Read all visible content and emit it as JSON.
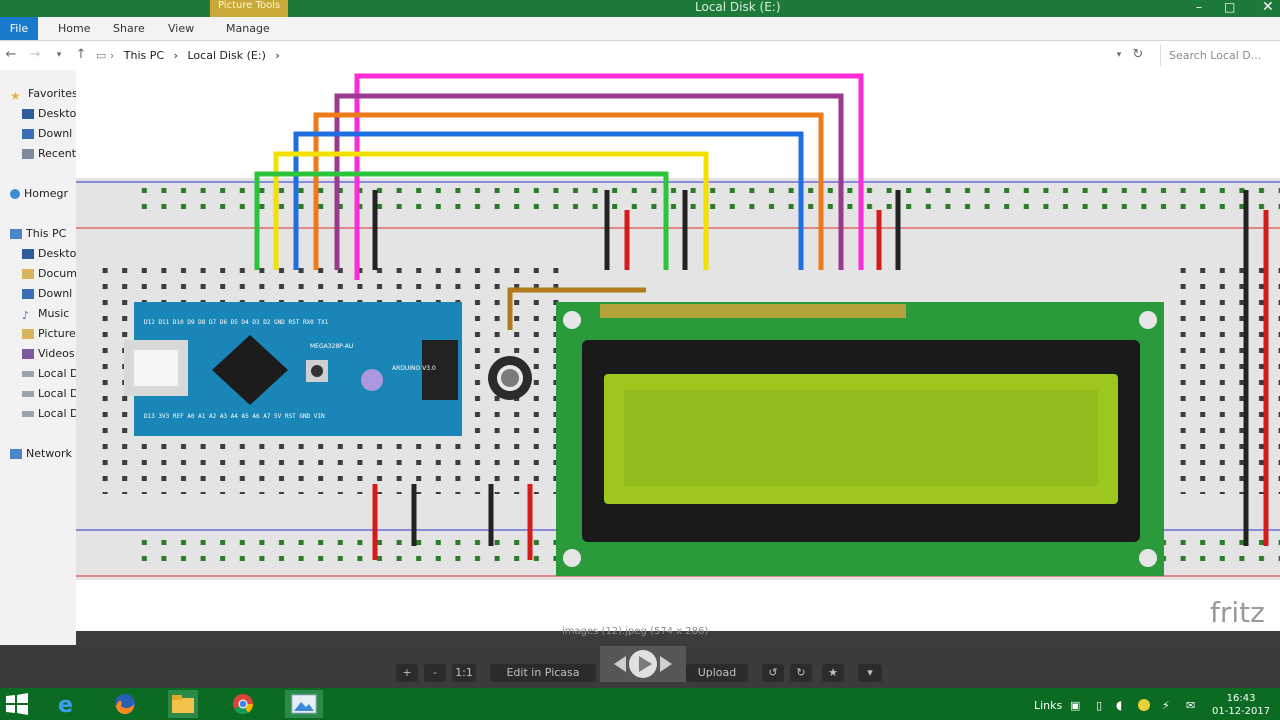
{
  "window": {
    "picture_tools": "Picture Tools",
    "title": "Local Disk (E:)"
  },
  "ribbon": {
    "file": "File",
    "tabs": [
      "Home",
      "Share",
      "View",
      "Manage"
    ]
  },
  "address": {
    "crumbs": [
      "This PC",
      "Local Disk (E:)"
    ],
    "search_placeholder": "Search Local D..."
  },
  "nav": {
    "favorites": "Favorites",
    "favorite_items": [
      "Deskto",
      "Downl",
      "Recent"
    ],
    "homegroup": "Homegr",
    "this_pc": "This PC",
    "pc_items": [
      "Deskto",
      "Docum",
      "Downl",
      "Music",
      "Picture",
      "Videos",
      "Local D",
      "Local D",
      "Local D"
    ],
    "network": "Network"
  },
  "image": {
    "watermark": "fritz",
    "board_labels": {
      "top_pins": "D12 D11 D10 D9 D8 D7 D6 D5 D4 D3 D2 GND RST RX0 TX1",
      "bottom_pins": "D13 3V3 REF A0 A1 A2 A3 A4 A5 A6 A7 5V RST GND VIN",
      "chip": "MEGA328P-AU",
      "side": "ARDUINO V3.0"
    }
  },
  "viewer": {
    "filename": "images (12).jpeg (574 x 286)",
    "zoom_in": "+",
    "zoom_out": "-",
    "actual": "1:1",
    "edit": "Edit in Picasa",
    "upload": "Upload",
    "rotate_left": "↺",
    "rotate_right": "↻",
    "star": "★",
    "more": "▾"
  },
  "taskbar": {
    "links": "Links",
    "time": "16:43",
    "date": "01-12-2017"
  }
}
